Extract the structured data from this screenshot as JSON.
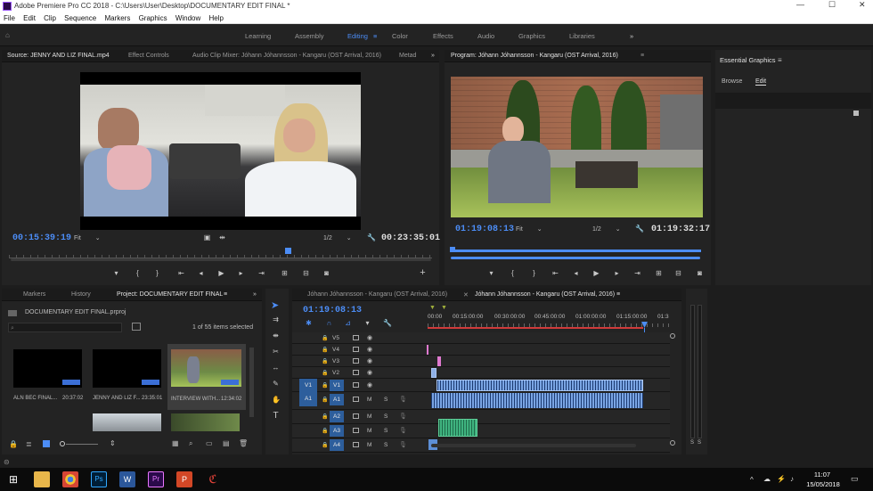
{
  "titlebar": {
    "title": "Adobe Premiere Pro CC 2018 - C:\\Users\\User\\Desktop\\DOCUMENTARY EDIT FINAL *"
  },
  "menu": [
    "File",
    "Edit",
    "Clip",
    "Sequence",
    "Markers",
    "Graphics",
    "Window",
    "Help"
  ],
  "workspaces": [
    "Learning",
    "Assembly",
    "Editing",
    "Color",
    "Effects",
    "Audio",
    "Graphics",
    "Libraries"
  ],
  "source": {
    "tabs": [
      "Source: JENNY AND LIZ FINAL.mp4",
      "Effect Controls",
      "Audio Clip Mixer: Jóhann Jóhannsson - Kangaru (OST Arrival, 2016)",
      "Metad"
    ],
    "timecode": "00:15:39:19",
    "fit": "Fit",
    "quality": "1/2",
    "duration": "00:23:35:01"
  },
  "program": {
    "tab": "Program: Jóhann Jóhannsson - Kangaru (OST Arrival, 2016)",
    "timecode": "01:19:08:13",
    "fit": "Fit",
    "quality": "1/2",
    "duration": "01:19:32:17"
  },
  "essential": {
    "title": "Essential Graphics",
    "browse": "Browse",
    "edit": "Edit"
  },
  "project": {
    "tabs": [
      "Markers",
      "History",
      "Project: DOCUMENTARY EDIT FINAL"
    ],
    "file": "DOCUMENTARY EDIT FINAL.prproj",
    "items_selected": "1 of 55 items selected",
    "thumbs": [
      {
        "name": "ALN BEC FINAL...",
        "dur": "20:37:02"
      },
      {
        "name": "JENNY AND LIZ F...",
        "dur": "23:35:01"
      },
      {
        "name": "INTERVIEW WITH...",
        "dur": "12:34:02"
      }
    ]
  },
  "timeline": {
    "tabs": [
      "Jóhann Jóhannsson - Kangaru (OST Arrival, 2016)",
      "Jóhann Jóhannsson - Kangaru (OST Arrival, 2016)"
    ],
    "timecode": "01:19:08:13",
    "ruler": [
      "00:00",
      "00:15:00:00",
      "00:30:00:00",
      "00:45:00:00",
      "01:00:00:00",
      "01:15:00:00",
      "01:3"
    ],
    "video_tracks": [
      "V5",
      "V4",
      "V3",
      "V2",
      "V1"
    ],
    "audio_tracks": [
      "A1",
      "A2",
      "A3",
      "A4"
    ],
    "src_v": "V1",
    "src_a": "A1",
    "mute": "M",
    "solo": "S"
  },
  "meter": {
    "s1": "S",
    "s2": "S"
  },
  "taskbar": {
    "time": "11:07",
    "date": "15/05/2018"
  }
}
